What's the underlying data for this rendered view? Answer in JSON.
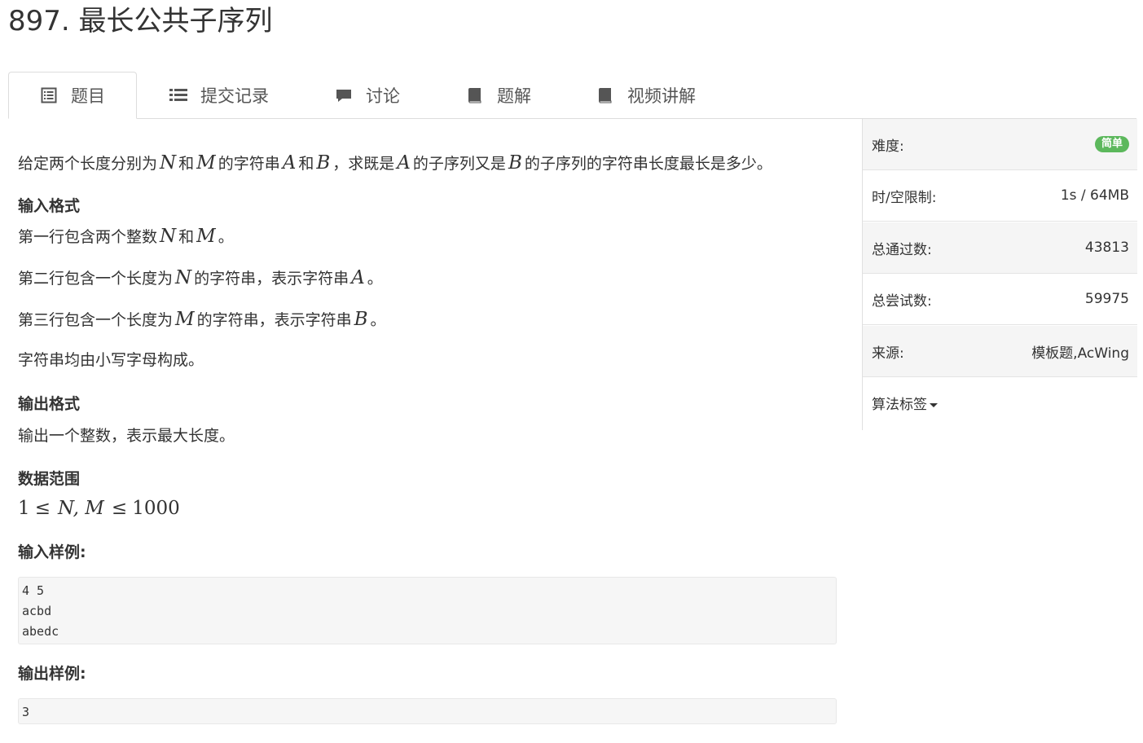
{
  "problem": {
    "title": "897. 最长公共子序列"
  },
  "tabs": [
    {
      "label": "题目",
      "icon": "list-alt-icon"
    },
    {
      "label": "提交记录",
      "icon": "list-icon"
    },
    {
      "label": "讨论",
      "icon": "comment-icon"
    },
    {
      "label": "题解",
      "icon": "book-icon"
    },
    {
      "label": "视频讲解",
      "icon": "book-icon"
    }
  ],
  "description": {
    "s1": "给定两个长度分别为",
    "N": "N",
    "he": "和",
    "M": "M",
    "s2": "的字符串",
    "A": "A",
    "B": "B",
    "s3": "，求既是",
    "s4": "的子序列又是",
    "s5": "的子序列的字符串长度最长是多少。"
  },
  "input_format": {
    "heading": "输入格式",
    "line1_prefix": "第一行包含两个整数",
    "period": "。",
    "line2_prefix": "第二行包含一个长度为",
    "line2_mid": "的字符串，表示字符串",
    "line3_prefix": "第三行包含一个长度为",
    "line4": "字符串均由小写字母构成。"
  },
  "output_format": {
    "heading": "输出格式",
    "line1": "输出一个整数，表示最大长度。"
  },
  "range": {
    "heading": "数据范围",
    "one": "1",
    "leq": "≤",
    "vars": "N, M",
    "max": "1000"
  },
  "sample_input": {
    "heading": "输入样例:",
    "text": "4 5\nacbd\nabedc"
  },
  "sample_output": {
    "heading": "输出样例:",
    "text": "3"
  },
  "sidebar": {
    "difficulty_label": "难度:",
    "difficulty_value": "简单",
    "difficulty_color": "#5cb85c",
    "limit_label": "时/空限制:",
    "limit_value": "1s / 64MB",
    "passed_label": "总通过数:",
    "passed_value": "43813",
    "tried_label": "总尝试数:",
    "tried_value": "59975",
    "source_label": "来源:",
    "source_value": "模板题,AcWing",
    "tags_label": "算法标签"
  }
}
